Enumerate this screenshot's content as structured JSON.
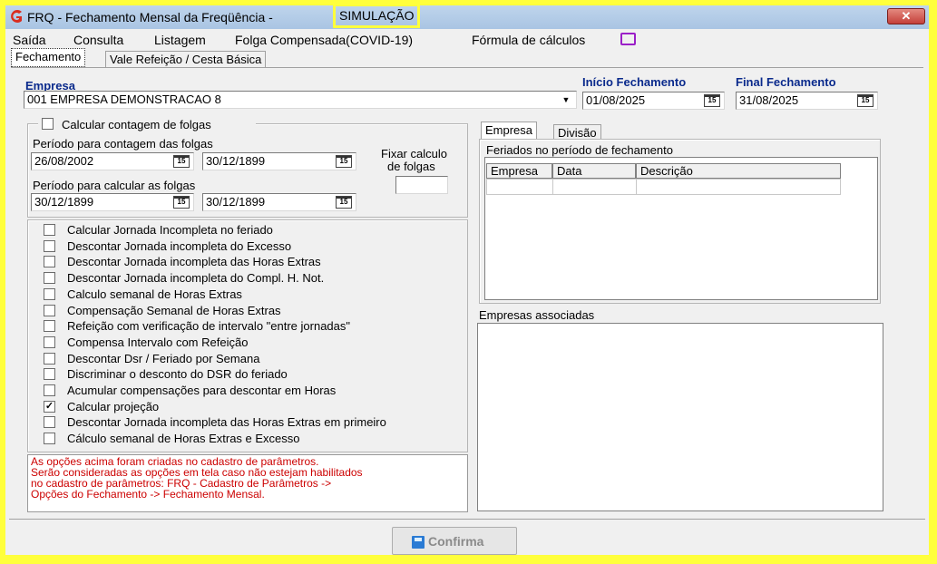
{
  "window": {
    "title_prefix": "FRQ - Fechamento Mensal da Freqüência -",
    "title_highlight": "SIMULAÇÃO",
    "close_label": "✕"
  },
  "menu": [
    "Saída",
    "Consulta",
    "Listagem",
    "Folga Compensada(COVID-19)",
    "Fórmula de cálculos"
  ],
  "tabs": [
    "Fechamento",
    "Vale Refeição / Cesta Básica"
  ],
  "empresa": {
    "label": "Empresa",
    "value": "001 EMPRESA DEMONSTRACAO 8"
  },
  "inicio": {
    "label": "Início Fechamento",
    "value": "01/08/2025"
  },
  "final": {
    "label": "Final Fechamento",
    "value": "31/08/2025"
  },
  "cal_icon": "15",
  "folgas": {
    "checkbox_label": "Calcular contagem de folgas",
    "periodo_contagem_label": "Período para contagem das folgas",
    "contagem_inicio": "26/08/2002",
    "contagem_fim": "30/12/1899",
    "periodo_calcular_label": "Período para calcular as folgas",
    "calcular_inicio": "30/12/1899",
    "calcular_fim": "30/12/1899",
    "fixar_label_1": "Fixar calculo",
    "fixar_label_2": "de folgas",
    "fixar_value": ""
  },
  "options": [
    {
      "label": "Calcular Jornada Incompleta no feriado",
      "checked": false
    },
    {
      "label": "Descontar Jornada incompleta do Excesso",
      "checked": false
    },
    {
      "label": "Descontar Jornada incompleta das Horas Extras",
      "checked": false
    },
    {
      "label": "Descontar Jornada incompleta do Compl. H. Not.",
      "checked": false
    },
    {
      "label": "Calculo semanal de Horas Extras",
      "checked": false
    },
    {
      "label": "Compensação Semanal de Horas Extras",
      "checked": false
    },
    {
      "label": "Refeição com verificação de intervalo  \"entre jornadas\"",
      "checked": false
    },
    {
      "label": "Compensa Intervalo com Refeição",
      "checked": false
    },
    {
      "label": "Descontar Dsr / Feriado por Semana",
      "checked": false
    },
    {
      "label": "Discriminar o desconto do DSR do feriado",
      "checked": false
    },
    {
      "label": "Acumular compensações para descontar em Horas",
      "checked": false
    },
    {
      "label": "Calcular projeção",
      "checked": true
    },
    {
      "label": "Descontar Jornada incompleta das Horas Extras em primeiro",
      "checked": false
    },
    {
      "label": "Cálculo semanal de Horas Extras e Excesso",
      "checked": false
    }
  ],
  "note": [
    "As opções acima foram criadas no cadastro de parâmetros.",
    "Serão consideradas as opções em tela caso não estejam habilitados",
    "no cadastro de parâmetros: FRQ - Cadastro de Parâmetros ->",
    "Opções do Fechamento -> Fechamento Mensal."
  ],
  "right_tabs": [
    "Empresa",
    "Divisão"
  ],
  "feriados": {
    "title": "Feriados no período de fechamento",
    "columns": [
      "Empresa",
      "Data",
      "Descrição"
    ]
  },
  "associadas": {
    "title": "Empresas associadas"
  },
  "confirma": {
    "label": "Confirma"
  },
  "colors": {
    "highlight": "#ffff3c",
    "note_text": "#cc0000",
    "label_blue": "#0a2a8c"
  }
}
